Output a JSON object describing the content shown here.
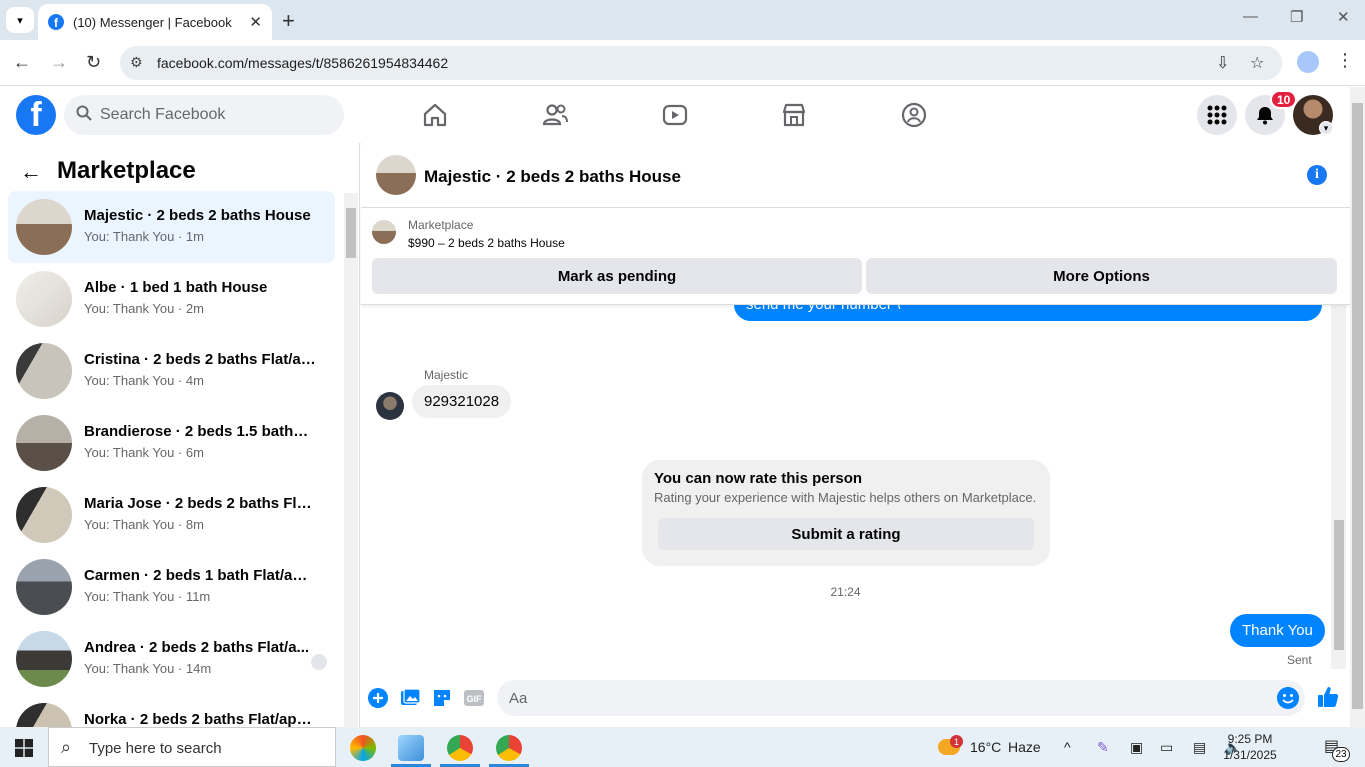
{
  "browser": {
    "tab_title": "(10) Messenger | Facebook",
    "url": "facebook.com/messages/t/8586261954834462"
  },
  "fb": {
    "logo_letter": "f",
    "search_placeholder": "Search Facebook",
    "notification_count": "10"
  },
  "sidebar": {
    "title": "Marketplace",
    "conversations": [
      {
        "name": "Majestic · 2 beds 2 baths House",
        "preview": "You: Thank You · 1m"
      },
      {
        "name": "Albe · 1 bed 1 bath House",
        "preview": "You: Thank You · 2m"
      },
      {
        "name": "Cristina · 2 beds 2 baths Flat/ap...",
        "preview": "You: Thank You · 4m"
      },
      {
        "name": "Brandierose · 2 beds 1.5 baths H...",
        "preview": "You: Thank You · 6m"
      },
      {
        "name": "Maria Jose · 2 beds 2 baths Flat/...",
        "preview": "You: Thank You · 8m"
      },
      {
        "name": "Carmen · 2 beds 1 bath Flat/apa...",
        "preview": "You: Thank You · 11m"
      },
      {
        "name": "Andrea · 2 beds 2 baths Flat/a...",
        "preview": "You: Thank You · 14m"
      },
      {
        "name": "Norka · 2 beds 2 baths Flat/apar...",
        "preview": ""
      }
    ]
  },
  "chat": {
    "title": "Majestic · 2 beds 2 baths House",
    "listing_source": "Marketplace",
    "listing_price": "$990 – 2 beds 2 baths House",
    "mark_pending_label": "Mark as pending",
    "more_options_label": "More Options",
    "partial_message": "send me your number \\",
    "sender_name": "Majestic",
    "incoming_message": "929321028",
    "rating_heading": "You can now rate this person",
    "rating_description": "Rating your experience with Majestic helps others on Marketplace.",
    "rating_button": "Submit a rating",
    "timestamp": "21:24",
    "outgoing_message": "Thank You",
    "status": "Sent",
    "composer_placeholder": "Aa"
  },
  "taskbar": {
    "search_text": "Type here to search",
    "weather_temp": "16°C",
    "weather_cond": "Haze",
    "weather_alert": "1",
    "time": "9:25 PM",
    "date": "1/31/2025",
    "notif_count": "23"
  },
  "colors": {
    "fb_blue": "#1877f2",
    "messenger_blue": "#0084ff",
    "active_row": "#ebf5ff",
    "badge_red": "#e41e3f"
  }
}
